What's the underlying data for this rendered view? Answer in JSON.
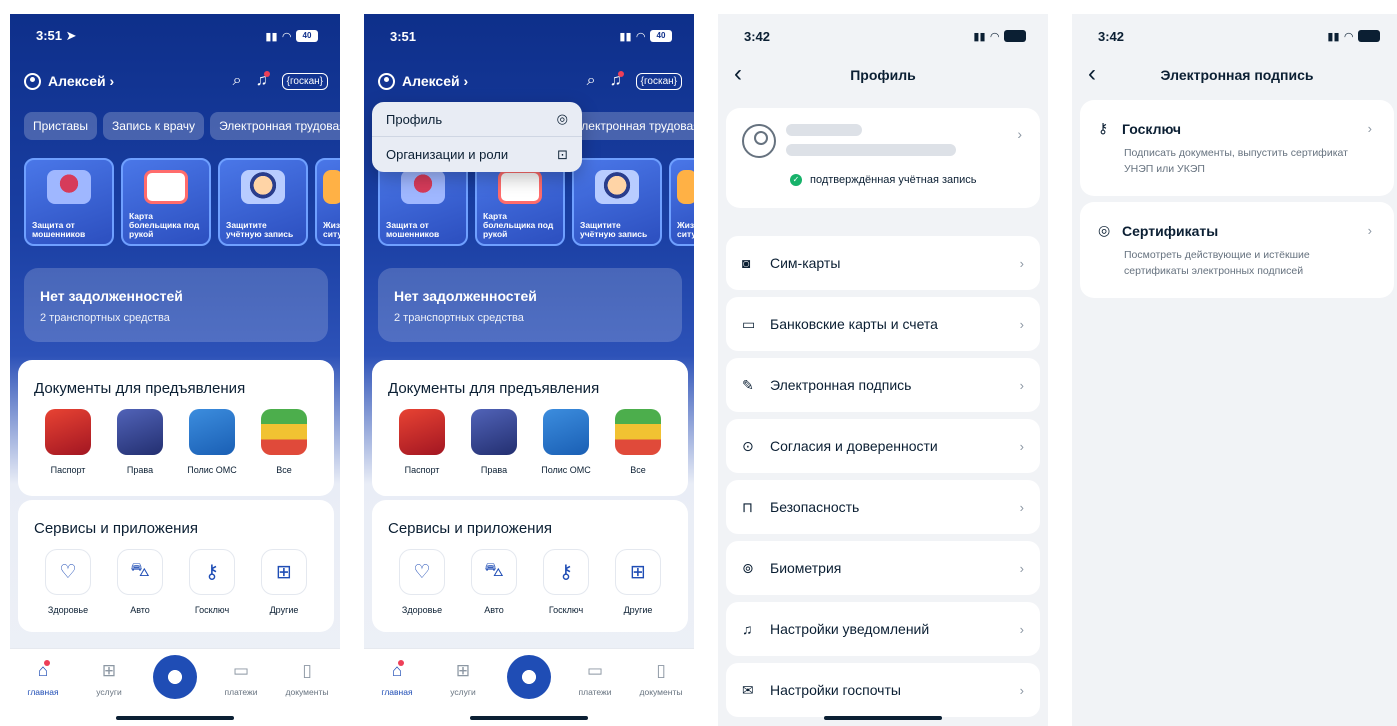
{
  "colors": {
    "brand_blue": "#1f4db5",
    "dark_bg": "#0e2f8a",
    "notification_red": "#ee3f58",
    "verified_green": "#17b26a"
  },
  "home": {
    "status_time_1": "3:51 ➤",
    "status_time_2": "3:51",
    "battery": "40",
    "user_name": "Алексей ›",
    "gos_button": "{госкан}",
    "chips": [
      "Приставы",
      "Запись к врачу",
      "Электронная трудовая"
    ],
    "stories": [
      "Защита от мошенников",
      "Карта болельщика под рукой",
      "Защитите учётную запись",
      "Жизн ситуа"
    ],
    "debt_title": "Нет задолженностей",
    "debt_sub": "2 транспортных средства",
    "documents_title": "Документы для предъявления",
    "documents": [
      "Паспорт",
      "Права",
      "Полис ОМС",
      "Все"
    ],
    "services_title": "Сервисы и приложения",
    "services": [
      "Здоровье",
      "Авто",
      "Госключ",
      "Другие"
    ],
    "tabs": [
      "главная",
      "услуги",
      "",
      "платежи",
      "документы"
    ]
  },
  "dropdown": {
    "items": [
      "Профиль",
      "Организации и роли"
    ]
  },
  "profile": {
    "status_time": "3:42",
    "title": "Профиль",
    "verified": "подтверждённая учётная запись",
    "rows": [
      "Сим-карты",
      "Банковские карты и счета",
      "Электронная подпись",
      "Согласия и доверенности",
      "Безопасность",
      "Биометрия",
      "Настройки уведомлений",
      "Настройки госпочты"
    ]
  },
  "signature": {
    "status_time": "3:42",
    "title": "Электронная подпись",
    "items": [
      {
        "title": "Госключ",
        "desc": "Подписать документы, выпустить сертификат УНЭП или УКЭП"
      },
      {
        "title": "Сертификаты",
        "desc": "Посмотреть действующие и истёкшие сертификаты электронных подписей"
      }
    ]
  },
  "icons": {
    "search": "search-icon",
    "bell": "bell-icon",
    "profile": "profile-icon",
    "briefcase": "briefcase-icon",
    "back": "chevron-left-icon",
    "chevron": "chevron-right-icon",
    "sim": "sim-card-icon",
    "bank": "bank-card-icon",
    "pen": "pen-icon",
    "check": "check-circle-icon",
    "lock": "lock-icon",
    "biometry": "face-scan-icon",
    "mail": "mail-icon",
    "key": "key-icon",
    "certificate": "certificate-icon"
  }
}
